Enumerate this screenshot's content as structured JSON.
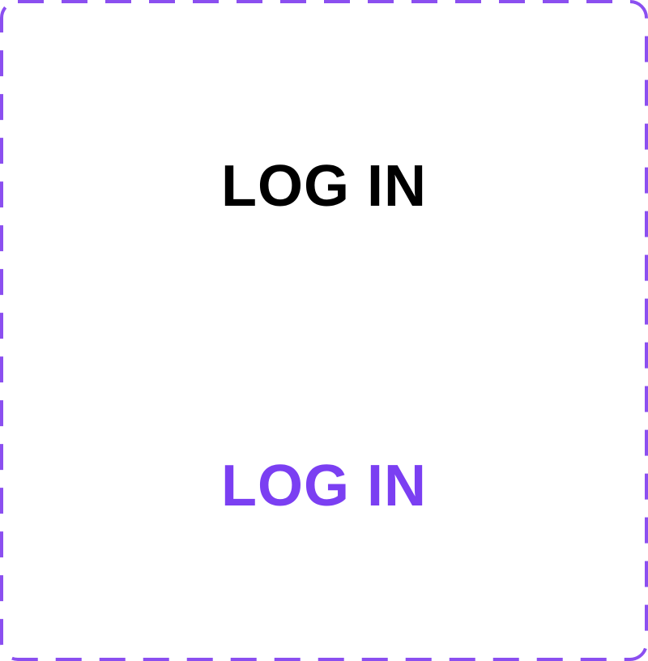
{
  "variants": {
    "default": {
      "label": "LOG IN",
      "color": "#000000"
    },
    "hover": {
      "label": "LOG IN",
      "color": "#7B3FF2"
    }
  },
  "frame": {
    "border_color": "#8B4FF0",
    "border_style": "dashed"
  }
}
